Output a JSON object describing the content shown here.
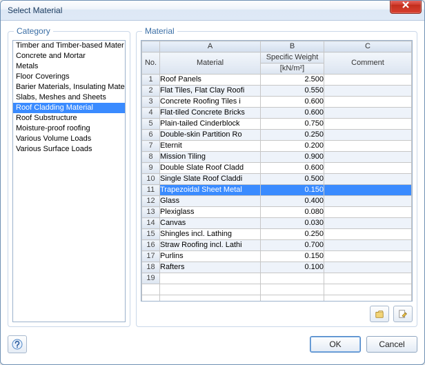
{
  "window": {
    "title": "Select Material",
    "ok_label": "OK",
    "cancel_label": "Cancel"
  },
  "category": {
    "title": "Category",
    "selected_index": 6,
    "items": [
      "Timber and Timber-based Mater",
      "Concrete and Mortar",
      "Metals",
      "Floor Coverings",
      "Barier Materials, Insulating Mate",
      "Slabs, Meshes and Sheets",
      "Roof Cladding Material",
      "Roof Substructure",
      "Moisture-proof roofing",
      "Various Volume Loads",
      "Various Surface Loads"
    ]
  },
  "material": {
    "title": "Material",
    "col_letters": {
      "no": "No.",
      "a": "A",
      "b": "B",
      "c": "C"
    },
    "col_headers": {
      "a": "Material",
      "b1": "Specific Weight",
      "b2": "[kN/m²]",
      "c": "Comment"
    },
    "selected_row_index": 10,
    "rows": [
      {
        "no": "1",
        "material": "Roof Panels",
        "weight": "2.500",
        "comment": ""
      },
      {
        "no": "2",
        "material": "Flat Tiles, Flat Clay Roofi",
        "weight": "0.550",
        "comment": ""
      },
      {
        "no": "3",
        "material": "Concrete Roofing Tiles i",
        "weight": "0.600",
        "comment": ""
      },
      {
        "no": "4",
        "material": "Flat-tiled Concrete Bricks",
        "weight": "0.600",
        "comment": ""
      },
      {
        "no": "5",
        "material": "Plain-tailed Cinderblock",
        "weight": "0.750",
        "comment": ""
      },
      {
        "no": "6",
        "material": "Double-skin Partition Ro",
        "weight": "0.250",
        "comment": ""
      },
      {
        "no": "7",
        "material": "Eternit",
        "weight": "0.200",
        "comment": ""
      },
      {
        "no": "8",
        "material": "Mission Tiling",
        "weight": "0.900",
        "comment": ""
      },
      {
        "no": "9",
        "material": "Double Slate Roof Cladd",
        "weight": "0.600",
        "comment": ""
      },
      {
        "no": "10",
        "material": "Single Slate Roof Claddi",
        "weight": "0.500",
        "comment": ""
      },
      {
        "no": "11",
        "material": "Trapezoidal Sheet Metal",
        "weight": "0.150",
        "comment": ""
      },
      {
        "no": "12",
        "material": "Glass",
        "weight": "0.400",
        "comment": ""
      },
      {
        "no": "13",
        "material": "Plexiglass",
        "weight": "0.080",
        "comment": ""
      },
      {
        "no": "14",
        "material": "Canvas",
        "weight": "0.030",
        "comment": ""
      },
      {
        "no": "15",
        "material": "Shingles incl. Lathing",
        "weight": "0.250",
        "comment": ""
      },
      {
        "no": "16",
        "material": "Straw Roofing incl. Lathi",
        "weight": "0.700",
        "comment": ""
      },
      {
        "no": "17",
        "material": "Purlins",
        "weight": "0.150",
        "comment": ""
      },
      {
        "no": "18",
        "material": "Rafters",
        "weight": "0.100",
        "comment": ""
      },
      {
        "no": "19",
        "material": "",
        "weight": "",
        "comment": ""
      }
    ],
    "free_rows": 5
  }
}
